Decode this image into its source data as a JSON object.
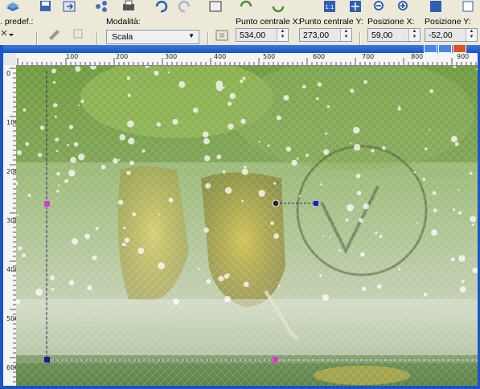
{
  "options": {
    "preset_label": ". predef.:",
    "mode_label": "Modalità:",
    "mode_value": "Scala",
    "center_x_label": "Punto centrale X:",
    "center_x_value": "534,00",
    "center_y_label": "Punto centrale Y:",
    "center_y_value": "273,00",
    "pos_x_label": "Posizione X:",
    "pos_x_value": "59,00",
    "pos_y_label": "Posizione Y:",
    "pos_y_value": "-52,00"
  },
  "rulers": {
    "h_ticks": [
      "100",
      "200",
      "300",
      "400",
      "500",
      "600",
      "700",
      "800",
      "900"
    ],
    "v_ticks": [
      "0",
      "100",
      "200",
      "300",
      "400",
      "500",
      "600"
    ]
  },
  "icons": [
    "layers-icon",
    "save-icon",
    "export-icon",
    "share-icon",
    "print-icon",
    "undo-icon",
    "redo-icon",
    "crop-icon",
    "refresh-icon",
    "actual-size-icon",
    "fit-window-icon",
    "zoom-out-icon",
    "zoom-in-icon",
    "help-icon",
    "copy-icon"
  ]
}
